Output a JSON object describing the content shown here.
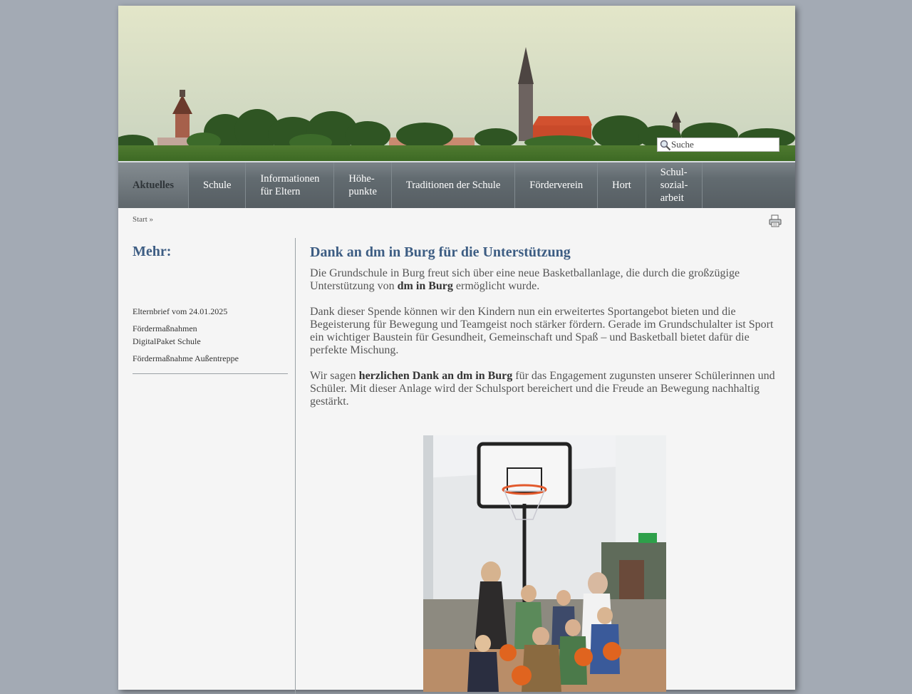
{
  "search": {
    "placeholder": "Suche"
  },
  "nav": {
    "items": [
      {
        "label": "Aktuelles",
        "active": true
      },
      {
        "label": "Schule"
      },
      {
        "label": "Informationen\nfür Eltern"
      },
      {
        "label": "Höhe-\npunkte"
      },
      {
        "label": "Traditionen der Schule"
      },
      {
        "label": "Förderverein"
      },
      {
        "label": "Hort"
      },
      {
        "label": "Schul-\nsozial-\narbeit"
      }
    ]
  },
  "breadcrumb": {
    "text": "Start »"
  },
  "print": {
    "icon": "printer-icon"
  },
  "sidebar": {
    "title": "Mehr:",
    "items": [
      {
        "label": "Elternbrief vom 24.01.2025"
      },
      {
        "label": "Fördermaßnahmen"
      },
      {
        "label": "DigitalPaket Schule"
      },
      {
        "label": "Fördermaßnahme Außentreppe"
      }
    ]
  },
  "article": {
    "title": "Dank an dm in Burg für die Unterstützung",
    "p1_pre": "Die Grundschule in Burg freut sich über eine neue Basketballanlage, die durch die großzügige Unterstützung von ",
    "p1_bold": "dm in Burg",
    "p1_post": " ermöglicht wurde.",
    "p2": "Dank dieser Spende können wir den Kindern nun ein erweitertes Sportangebot bieten und die Begeisterung für Bewegung und Teamgeist noch stärker fördern. Gerade im Grundschulalter ist Sport ein wichtiger Baustein für Gesundheit, Gemeinschaft und Spaß – und Basketball bietet dafür die perfekte Mischung.",
    "p3_pre": "Wir sagen ",
    "p3_bold": "herzlichen Dank an dm in Burg",
    "p3_post": " für das Engagement zugunsten unserer Schülerinnen und Schüler. Mit dieser Anlage wird der Schulsport bereichert und die Freude an Bewegung nachhaltig gestärkt."
  },
  "colors": {
    "nav_bg": "#5b6368",
    "heading": "#3d5d83",
    "page_bg": "#a3aab4"
  }
}
